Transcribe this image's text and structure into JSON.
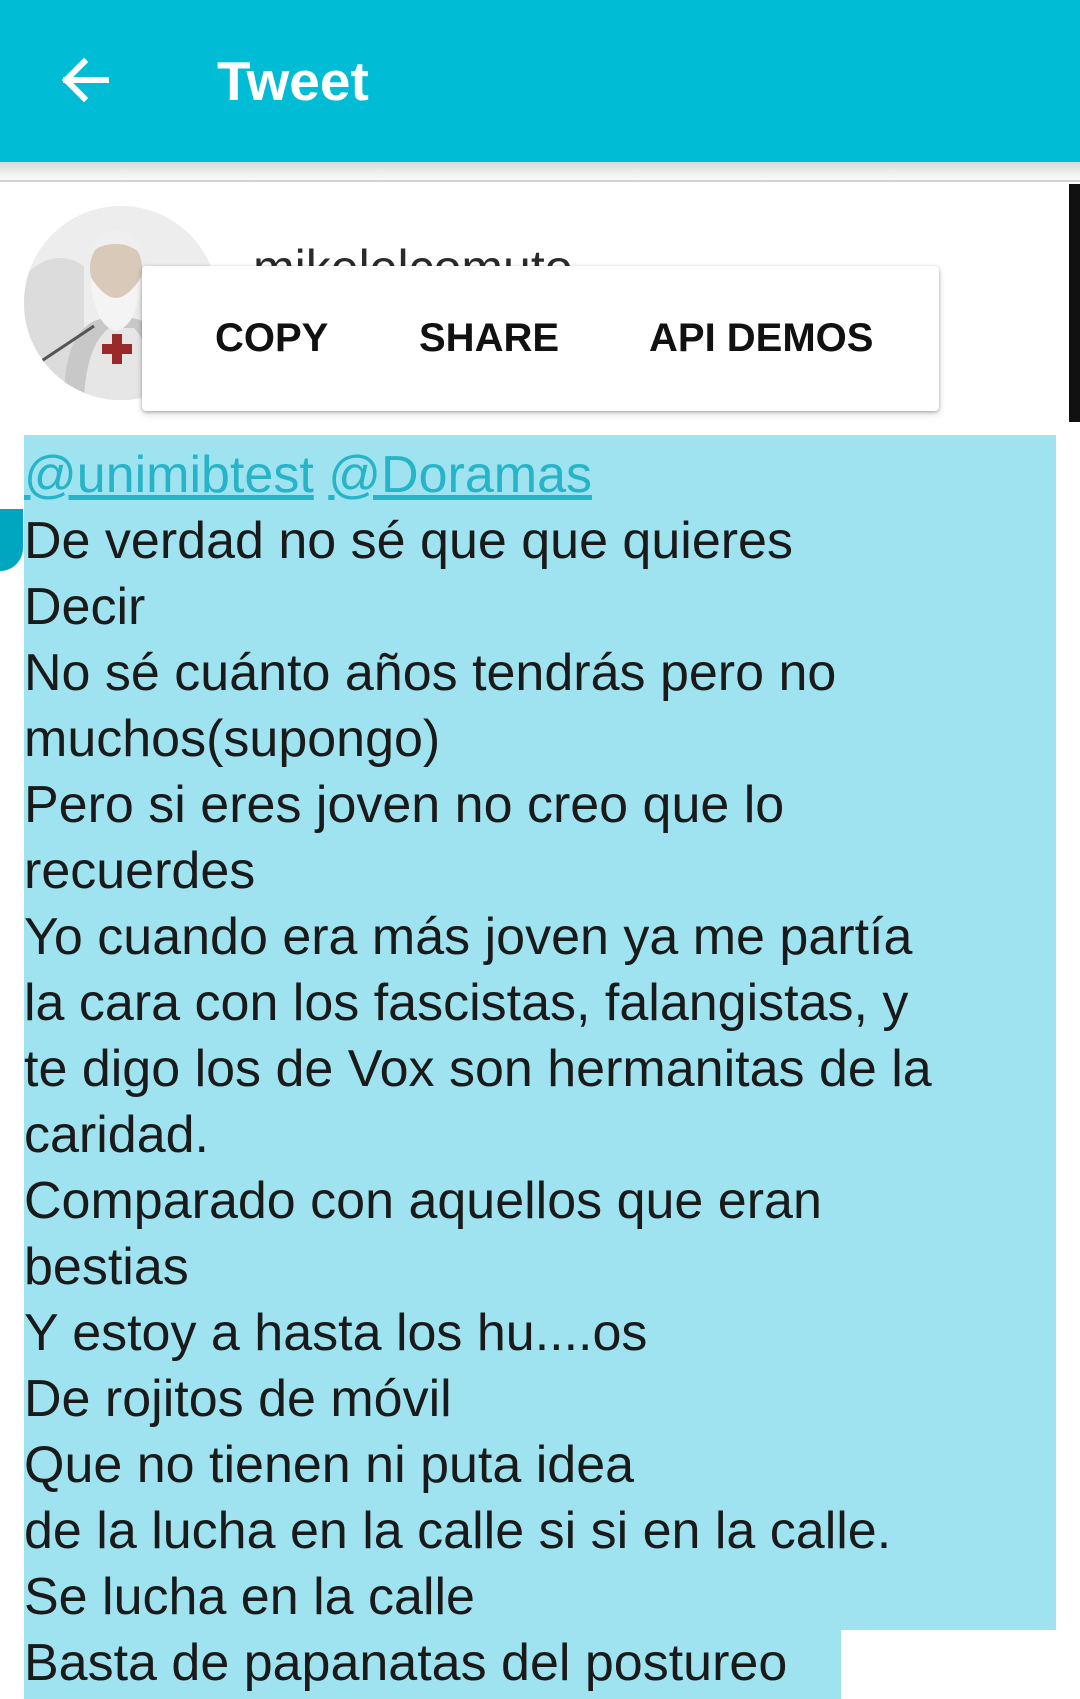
{
  "app_bar": {
    "title": "Tweet",
    "back_icon": "arrow-left-icon",
    "background_color": "#00bcd4"
  },
  "tweet": {
    "user_name": "mikelelcomuto",
    "mentions": [
      "@unimibtest",
      "@Doramas"
    ],
    "lines": [
      "De verdad no sé que que quieres",
      "Decir",
      "No sé cuánto años tendrás pero no",
      "muchos(supongo)",
      "Pero si eres joven no creo que lo",
      "recuerdes",
      "Yo cuando era más joven ya me partía",
      "la cara con los fascistas, falangistas, y",
      "te digo los de Vox son hermanitas de la",
      "caridad.",
      "Comparado con aquellos que eran",
      "bestias",
      "Y estoy a hasta los hu....os",
      "De rojitos de móvil",
      "Que no tienen ni puta idea",
      "de la lucha en la calle si si en la calle.",
      "Se lucha en la calle",
      "Basta de papanatas del postureo"
    ]
  },
  "context_menu": {
    "items": [
      "COPY",
      "SHARE",
      "API DEMOS"
    ]
  },
  "colors": {
    "accent": "#00bcd4",
    "selection": "#9ee3ef",
    "link": "#27b4c8"
  }
}
